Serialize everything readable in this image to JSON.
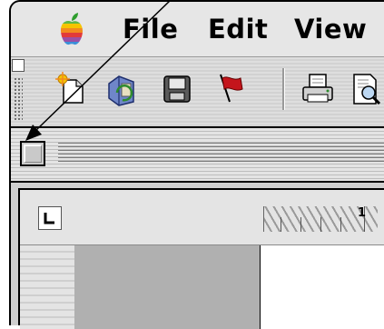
{
  "menubar": {
    "apple_icon": "apple-logo-icon",
    "items": [
      {
        "label": "File"
      },
      {
        "label": "Edit"
      },
      {
        "label": "View"
      }
    ]
  },
  "toolbar": {
    "buttons": [
      {
        "icon": "new-document-icon"
      },
      {
        "icon": "open-folder-icon"
      },
      {
        "icon": "save-disk-icon"
      },
      {
        "icon": "flag-icon"
      },
      {
        "icon": "print-icon"
      },
      {
        "icon": "print-preview-icon"
      }
    ]
  },
  "ruler": {
    "tab_stop_icon": "left-tab-icon",
    "first_number": "1"
  },
  "annotation": {
    "color": "#000000"
  }
}
